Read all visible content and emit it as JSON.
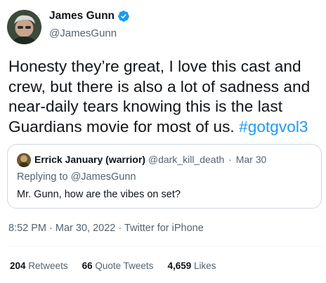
{
  "author": {
    "name": "James Gunn",
    "handle": "@JamesGunn",
    "verified_color": "#1d9bf0"
  },
  "tweet": {
    "text_plain": "Honesty they’re great, I love this cast and crew, but there is also a lot of sadness and near-daily tears knowing this is the last Guardians movie for most of us. ",
    "hashtag": "#gotgvol3",
    "hashtag_color": "#1d9bf0"
  },
  "quote": {
    "name": "Errick January (warrior)",
    "handle": "@dark_kill_death",
    "separator": "·",
    "date": "Mar 30",
    "replying_prefix": "Replying to ",
    "replying_handle": "@JamesGunn",
    "text": "Mr. Gunn, how are the vibes on set?"
  },
  "meta": {
    "time": "8:52 PM",
    "separator1": " · ",
    "date": "Mar 30, 2022",
    "separator2": " · ",
    "source": "Twitter for iPhone"
  },
  "stats": [
    {
      "count": "204",
      "label": "Retweets"
    },
    {
      "count": "66",
      "label": "Quote Tweets"
    },
    {
      "count": "4,659",
      "label": "Likes"
    }
  ]
}
